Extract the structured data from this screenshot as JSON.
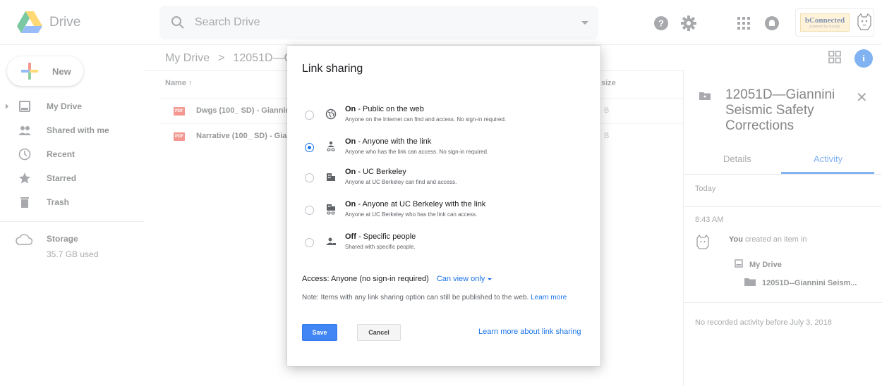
{
  "header": {
    "app_name": "Drive",
    "search_placeholder": "Search Drive",
    "brand_text": "bConnected",
    "brand_sub": "powered by Google"
  },
  "sidebar": {
    "new_label": "New",
    "items": [
      {
        "label": "My Drive",
        "icon": "my-drive-icon"
      },
      {
        "label": "Shared with me",
        "icon": "shared-icon"
      },
      {
        "label": "Recent",
        "icon": "clock-icon"
      },
      {
        "label": "Starred",
        "icon": "star-icon"
      },
      {
        "label": "Trash",
        "icon": "trash-icon"
      }
    ],
    "storage_label": "Storage",
    "storage_used": "35.7 GB used"
  },
  "main": {
    "breadcrumb": {
      "root": "My Drive",
      "separator": ">",
      "current": "12051D—G"
    },
    "columns": {
      "name": "Name ↑",
      "size": "size"
    },
    "files": [
      {
        "name": "Dwgs (100_ SD) - Giannin",
        "size": "B",
        "icon": "pdf-icon"
      },
      {
        "name": "Narrative (100_ SD) - Giar",
        "size": "B",
        "icon": "pdf-icon"
      }
    ]
  },
  "panel": {
    "title": "12051D—Giannini Seismic Safety Corrections",
    "tabs": {
      "details": "Details",
      "activity": "Activity"
    },
    "today": "Today",
    "time": "8:43 AM",
    "activity_actor": "You",
    "activity_text": "created an item in",
    "activity_drive": "My Drive",
    "activity_folder": "12051D--Giannini Seism...",
    "no_recorded": "No recorded activity before July 3, 2018"
  },
  "modal": {
    "title": "Link sharing",
    "options": [
      {
        "status": "On",
        "title": " - Public on the web",
        "desc": "Anyone on the Internet can find and access. No sign-in required.",
        "checked": false
      },
      {
        "status": "On",
        "title": " - Anyone with the link",
        "desc": "Anyone who has the link can access. No sign-in required.",
        "checked": true
      },
      {
        "status": "On",
        "title": " - UC Berkeley",
        "desc": "Anyone at UC Berkeley can find and access.",
        "checked": false
      },
      {
        "status": "On",
        "title": " - Anyone at UC Berkeley with the link",
        "desc": "Anyone at UC Berkeley who has the link can access.",
        "checked": false
      },
      {
        "status": "Off",
        "title": " - Specific people",
        "desc": "Shared with specific people.",
        "checked": false
      }
    ],
    "access_label": "Access:  Anyone (no sign-in required)",
    "access_value": "Can view only",
    "note": "Note: Items with any link sharing option can still be published to the web.",
    "note_link": "Learn more",
    "save": "Save",
    "cancel": "Cancel",
    "learn_more": "Learn more about link sharing"
  },
  "colors": {
    "accent": "#1a73e8",
    "save_button": "#4285f4",
    "pdf": "#e94235"
  }
}
